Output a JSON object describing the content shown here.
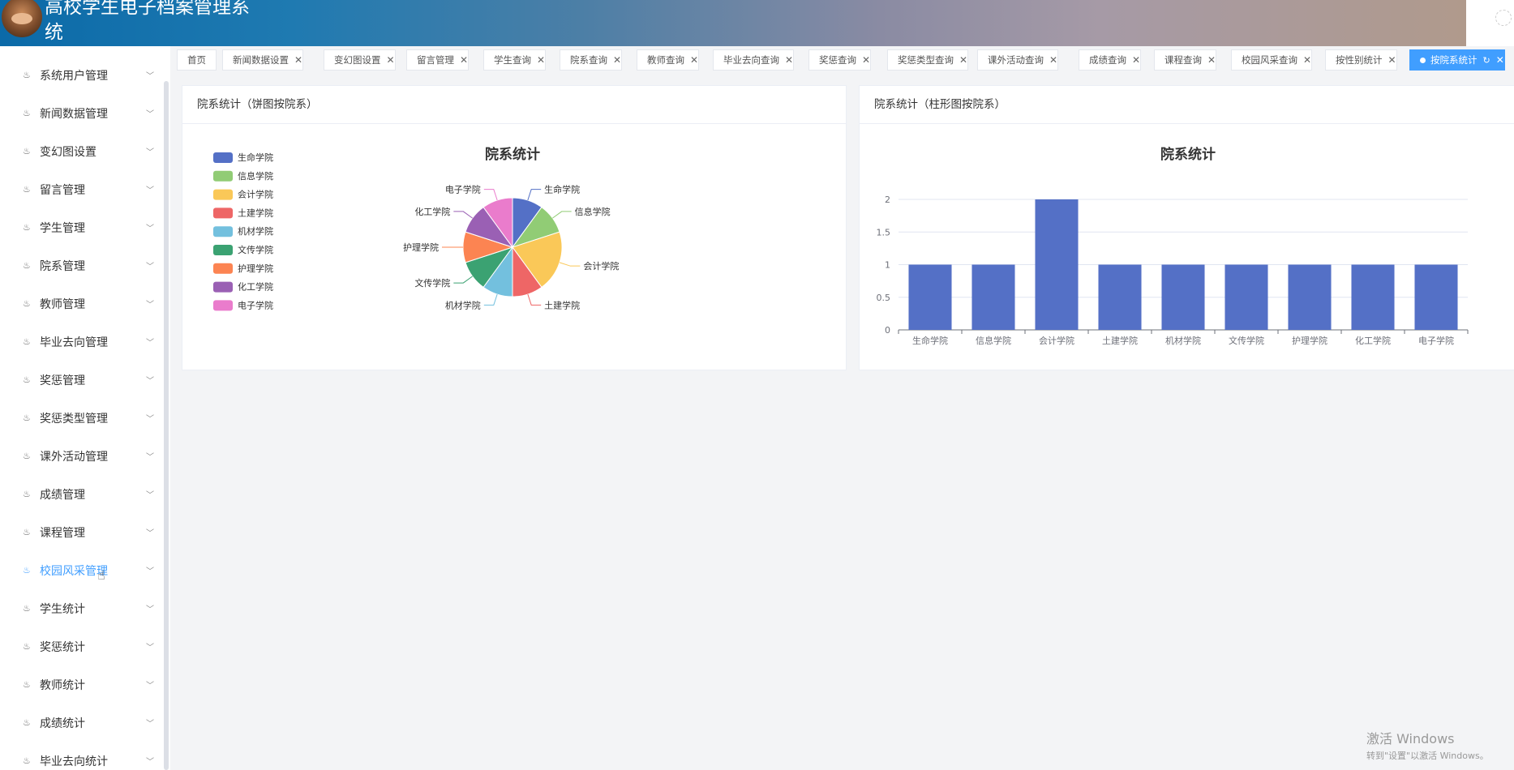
{
  "app": {
    "title": "高校学生电子档案管理系统"
  },
  "sidebar": {
    "items": [
      {
        "label": "系统用户管理",
        "icon": "menu-icon"
      },
      {
        "label": "新闻数据管理",
        "icon": "menu-icon"
      },
      {
        "label": "变幻图设置",
        "icon": "menu-icon"
      },
      {
        "label": "留言管理",
        "icon": "menu-icon"
      },
      {
        "label": "学生管理",
        "icon": "menu-icon"
      },
      {
        "label": "院系管理",
        "icon": "menu-icon"
      },
      {
        "label": "教师管理",
        "icon": "menu-icon"
      },
      {
        "label": "毕业去向管理",
        "icon": "menu-icon"
      },
      {
        "label": "奖惩管理",
        "icon": "menu-icon"
      },
      {
        "label": "奖惩类型管理",
        "icon": "menu-icon"
      },
      {
        "label": "课外活动管理",
        "icon": "menu-icon"
      },
      {
        "label": "成绩管理",
        "icon": "menu-icon"
      },
      {
        "label": "课程管理",
        "icon": "menu-icon"
      },
      {
        "label": "校园风采管理",
        "icon": "menu-icon",
        "active": true
      },
      {
        "label": "学生统计",
        "icon": "menu-icon"
      },
      {
        "label": "奖惩统计",
        "icon": "menu-icon"
      },
      {
        "label": "教师统计",
        "icon": "menu-icon"
      },
      {
        "label": "成绩统计",
        "icon": "menu-icon"
      },
      {
        "label": "毕业去向统计",
        "icon": "menu-icon"
      }
    ]
  },
  "tabs": [
    {
      "label": "首页",
      "closable": false
    },
    {
      "label": "新闻数据设置",
      "closable": true
    },
    {
      "label": "变幻图设置",
      "closable": true
    },
    {
      "label": "留言管理",
      "closable": true
    },
    {
      "label": "学生查询",
      "closable": true
    },
    {
      "label": "院系查询",
      "closable": true
    },
    {
      "label": "教师查询",
      "closable": true
    },
    {
      "label": "毕业去向查询",
      "closable": true
    },
    {
      "label": "奖惩查询",
      "closable": true
    },
    {
      "label": "奖惩类型查询",
      "closable": true
    },
    {
      "label": "课外活动查询",
      "closable": true
    },
    {
      "label": "成绩查询",
      "closable": true
    },
    {
      "label": "课程查询",
      "closable": true
    },
    {
      "label": "校园风采查询",
      "closable": true
    },
    {
      "label": "按性别统计",
      "closable": true
    },
    {
      "label": "按院系统计",
      "closable": true,
      "active": true
    }
  ],
  "cards": {
    "pie": {
      "header": "院系统计（饼图按院系）"
    },
    "bar": {
      "header": "院系统计（柱形图按院系）"
    }
  },
  "chart_data": [
    {
      "type": "pie",
      "title": "院系统计",
      "categories": [
        "生命学院",
        "信息学院",
        "会计学院",
        "土建学院",
        "机材学院",
        "文传学院",
        "护理学院",
        "化工学院",
        "电子学院"
      ],
      "values": [
        1,
        1,
        2,
        1,
        1,
        1,
        1,
        1,
        1
      ],
      "colors": [
        "#5470c6",
        "#91cc75",
        "#fac858",
        "#ee6666",
        "#73c0de",
        "#3ba272",
        "#fc8452",
        "#9a60b4",
        "#ea7ccc"
      ],
      "legend": "left"
    },
    {
      "type": "bar",
      "title": "院系统计",
      "categories": [
        "生命学院",
        "信息学院",
        "会计学院",
        "土建学院",
        "机材学院",
        "文传学院",
        "护理学院",
        "化工学院",
        "电子学院"
      ],
      "values": [
        1,
        1,
        2,
        1,
        1,
        1,
        1,
        1,
        1
      ],
      "ylim": [
        0,
        2
      ],
      "yticks": [
        "0",
        "0.5",
        "1",
        "1.5",
        "2"
      ],
      "color": "#5470c6",
      "grid": true
    }
  ],
  "watermark": {
    "line1": "激活 Windows",
    "line2": "转到\"设置\"以激活 Windows。"
  }
}
